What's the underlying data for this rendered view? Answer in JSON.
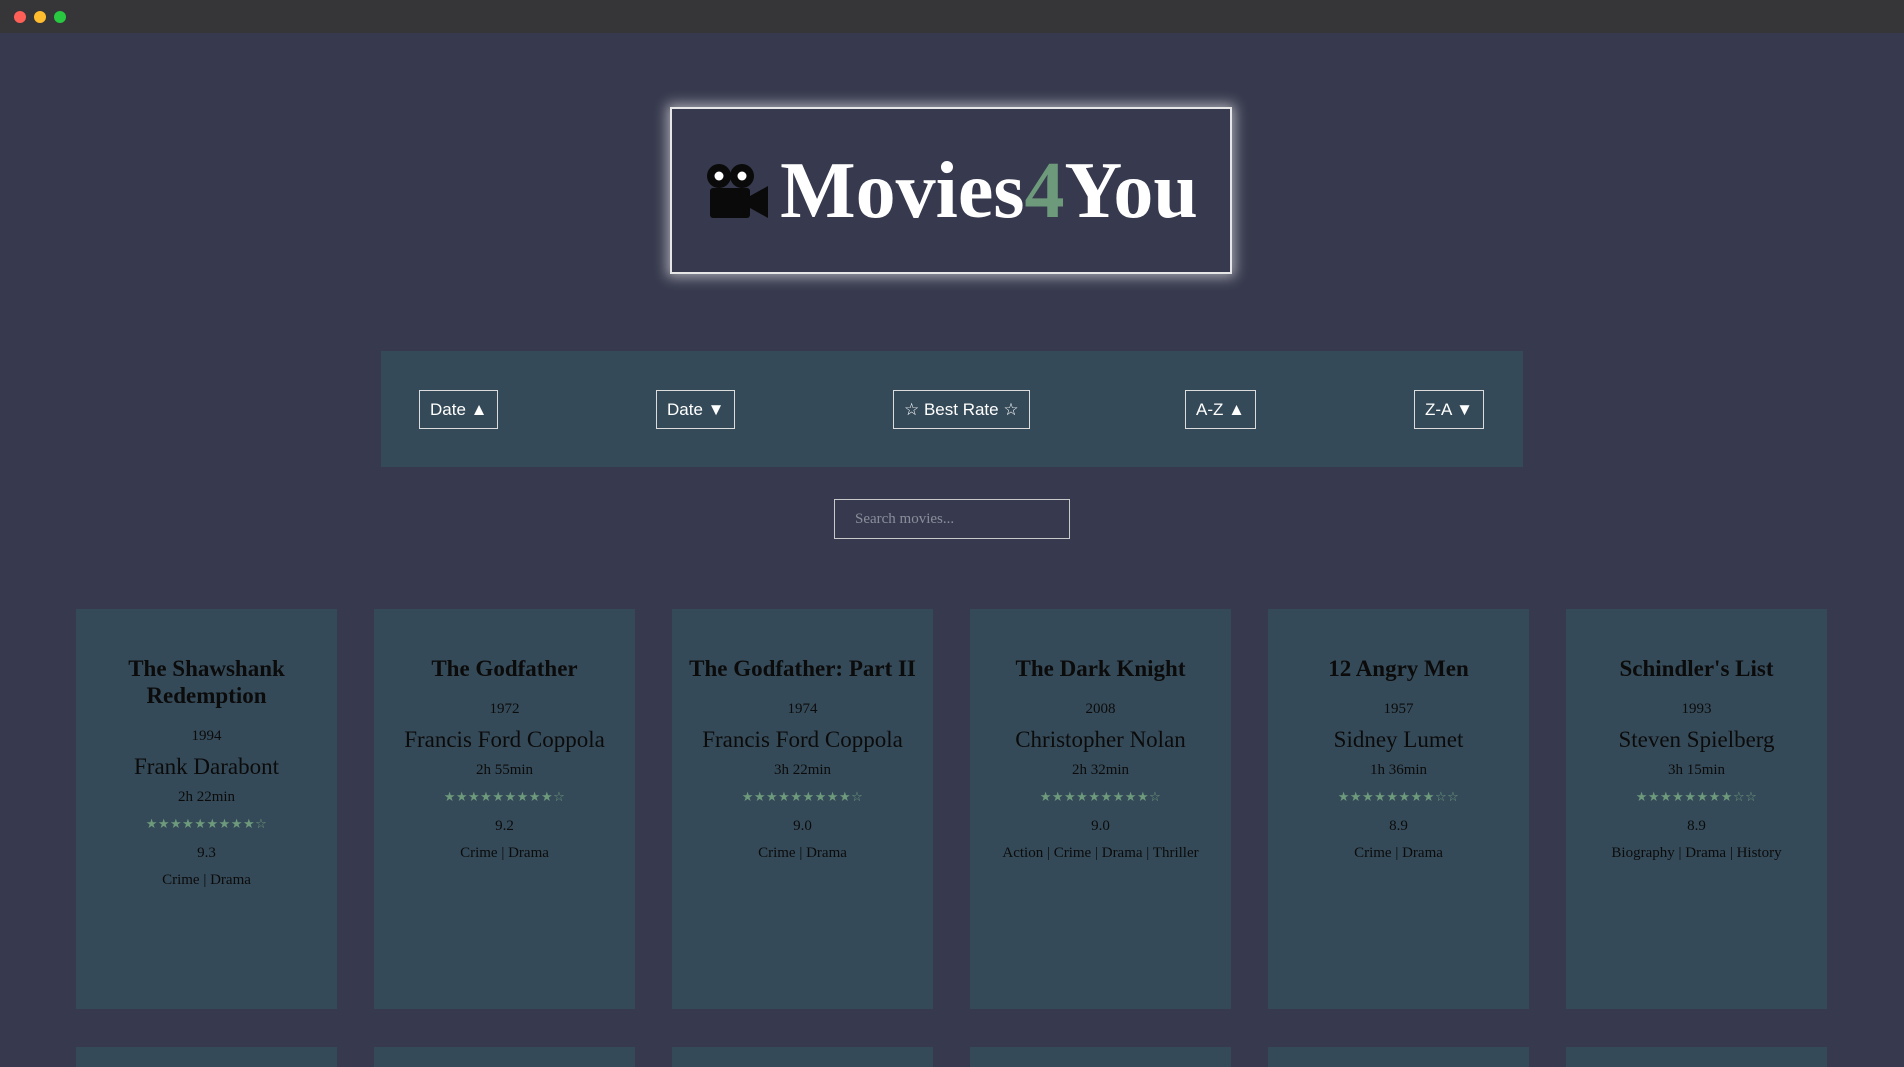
{
  "window": {
    "controls": [
      "close",
      "minimize",
      "maximize"
    ]
  },
  "header": {
    "logo_icon": "movie-camera-icon",
    "logo_text_part1": "Movies",
    "logo_text_accent": "4",
    "logo_text_part2": "You",
    "accent_color": "#6e9a7c"
  },
  "sort_buttons": [
    {
      "label": "Date ▲"
    },
    {
      "label": "Date ▼"
    },
    {
      "label": "☆ Best Rate ☆"
    },
    {
      "label": "A-Z ▲"
    },
    {
      "label": "Z-A ▼"
    }
  ],
  "search": {
    "placeholder": "Search movies...",
    "value": ""
  },
  "movies": [
    {
      "title": "The Shawshank Redemption",
      "year": "1994",
      "director": "Frank Darabont",
      "runtime": "2h 22min",
      "stars": "★★★★★★★★★☆",
      "rating": "9.3",
      "genres": [
        "Crime",
        "Drama"
      ]
    },
    {
      "title": "The Godfather",
      "year": "1972",
      "director": "Francis Ford Coppola",
      "runtime": "2h 55min",
      "stars": "★★★★★★★★★☆",
      "rating": "9.2",
      "genres": [
        "Crime",
        "Drama"
      ]
    },
    {
      "title": "The Godfather: Part II",
      "year": "1974",
      "director": "Francis Ford Coppola",
      "runtime": "3h 22min",
      "stars": "★★★★★★★★★☆",
      "rating": "9.0",
      "genres": [
        "Crime",
        "Drama"
      ]
    },
    {
      "title": "The Dark Knight",
      "year": "2008",
      "director": "Christopher Nolan",
      "runtime": "2h 32min",
      "stars": "★★★★★★★★★☆",
      "rating": "9.0",
      "genres": [
        "Action",
        "Crime",
        "Drama",
        "Thriller"
      ]
    },
    {
      "title": "12 Angry Men",
      "year": "1957",
      "director": "Sidney Lumet",
      "runtime": "1h 36min",
      "stars": "★★★★★★★★☆☆",
      "rating": "8.9",
      "genres": [
        "Crime",
        "Drama"
      ]
    },
    {
      "title": "Schindler's List",
      "year": "1993",
      "director": "Steven Spielberg",
      "runtime": "3h 15min",
      "stars": "★★★★★★★★☆☆",
      "rating": "8.9",
      "genres": [
        "Biography",
        "Drama",
        "History"
      ]
    }
  ]
}
